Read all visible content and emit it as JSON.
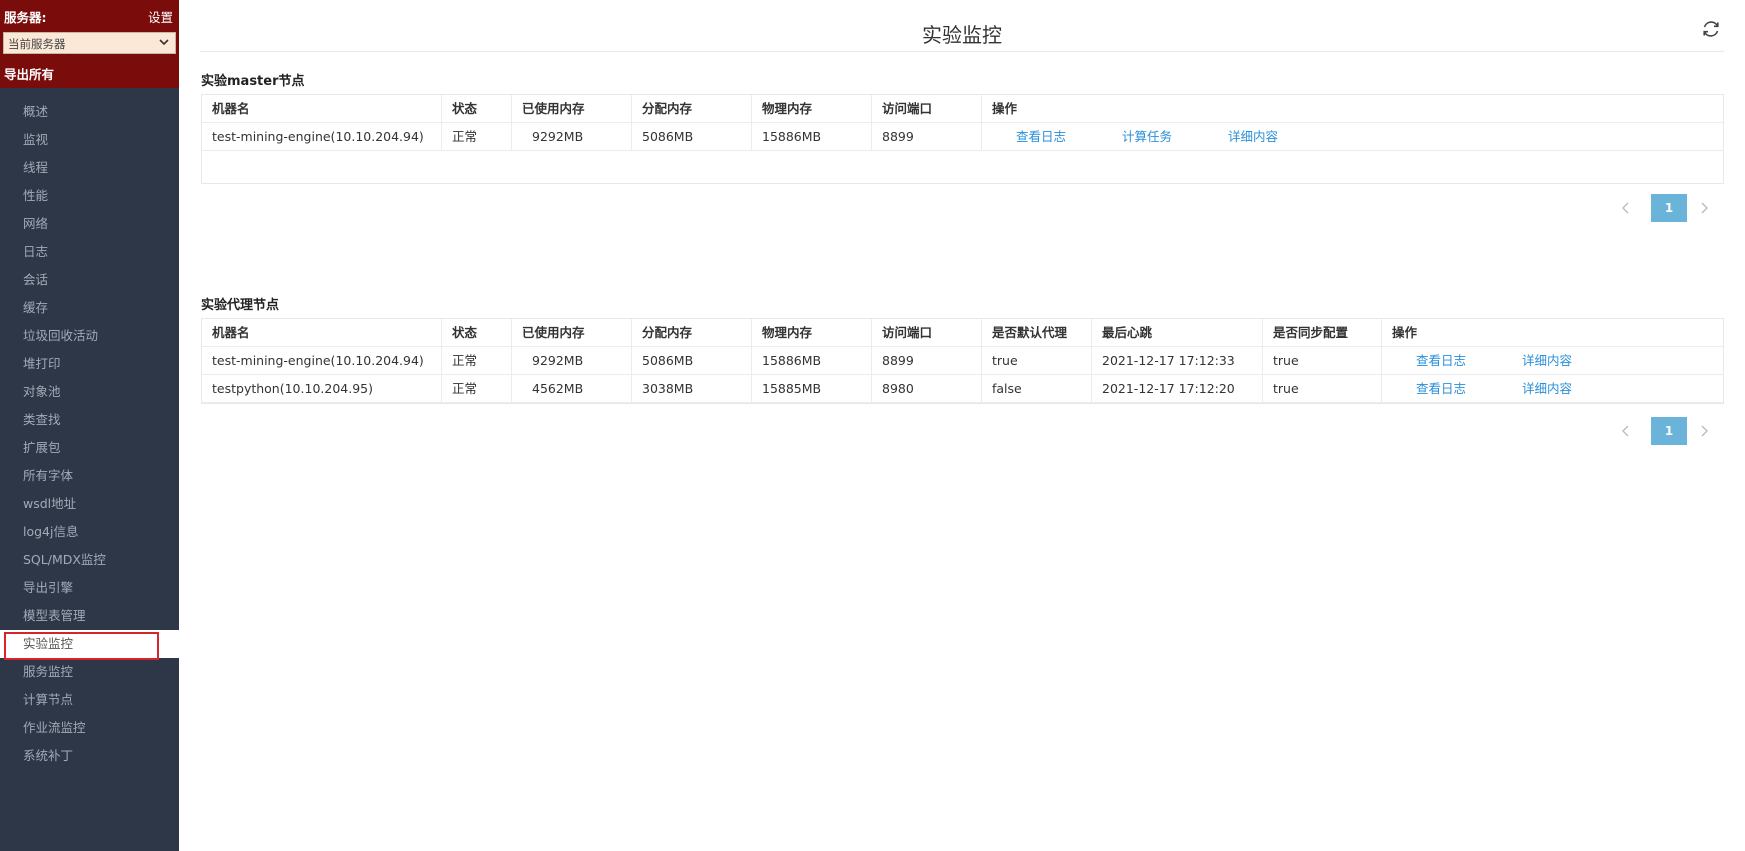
{
  "sidebar": {
    "title": "服务器:",
    "settings": "设置",
    "server_select": "当前服务器",
    "export_all": "导出所有",
    "items": [
      {
        "label": "概述"
      },
      {
        "label": "监视"
      },
      {
        "label": "线程"
      },
      {
        "label": "性能"
      },
      {
        "label": "网络"
      },
      {
        "label": "日志"
      },
      {
        "label": "会话"
      },
      {
        "label": "缓存"
      },
      {
        "label": "垃圾回收活动"
      },
      {
        "label": "堆打印"
      },
      {
        "label": "对象池"
      },
      {
        "label": "类查找"
      },
      {
        "label": "扩展包"
      },
      {
        "label": "所有字体"
      },
      {
        "label": "wsdl地址"
      },
      {
        "label": "log4j信息"
      },
      {
        "label": "SQL/MDX监控"
      },
      {
        "label": "导出引擎"
      },
      {
        "label": "模型表管理"
      },
      {
        "label": "实验监控",
        "active": true
      },
      {
        "label": "服务监控"
      },
      {
        "label": "计算节点"
      },
      {
        "label": "作业流监控"
      },
      {
        "label": "系统补丁"
      }
    ]
  },
  "header": {
    "title": "实验监控"
  },
  "master": {
    "title": "实验master节点",
    "columns": [
      "机器名",
      "状态",
      "已使用内存",
      "分配内存",
      "物理内存",
      "访问端口",
      "操作"
    ],
    "rows": [
      {
        "machine": "test-mining-engine(10.10.204.94)",
        "status": "正常",
        "used_mem": "9292MB",
        "alloc_mem": "5086MB",
        "phys_mem": "15886MB",
        "port": "8899",
        "actions": [
          "查看日志",
          "计算任务",
          "详细内容"
        ]
      }
    ],
    "pagination": {
      "current": "1"
    }
  },
  "agents": {
    "title": "实验代理节点",
    "columns": [
      "机器名",
      "状态",
      "已使用内存",
      "分配内存",
      "物理内存",
      "访问端口",
      "是否默认代理",
      "最后心跳",
      "是否同步配置",
      "操作"
    ],
    "rows": [
      {
        "machine": "test-mining-engine(10.10.204.94)",
        "status": "正常",
        "used_mem": "9292MB",
        "alloc_mem": "5086MB",
        "phys_mem": "15886MB",
        "port": "8899",
        "is_default": "true",
        "heartbeat": "2021-12-17 17:12:33",
        "sync_config": "true",
        "actions": [
          "查看日志",
          "详细内容"
        ]
      },
      {
        "machine": "testpython(10.10.204.95)",
        "status": "正常",
        "used_mem": "4562MB",
        "alloc_mem": "3038MB",
        "phys_mem": "15885MB",
        "port": "8980",
        "is_default": "false",
        "heartbeat": "2021-12-17 17:12:20",
        "sync_config": "true",
        "actions": [
          "查看日志",
          "详细内容"
        ]
      }
    ],
    "pagination": {
      "current": "1"
    }
  },
  "colors": {
    "sidebar_bg": "#2d3748",
    "sidebar_header_bg": "#7b0c0c",
    "link": "#2b8fd9",
    "page_active": "#6ab3d9",
    "highlight_border": "#d6252a"
  },
  "icons": {
    "refresh": "refresh-icon",
    "select_chevron": "chevron-down-icon",
    "prev": "chevron-left-icon",
    "next": "chevron-right-icon"
  }
}
